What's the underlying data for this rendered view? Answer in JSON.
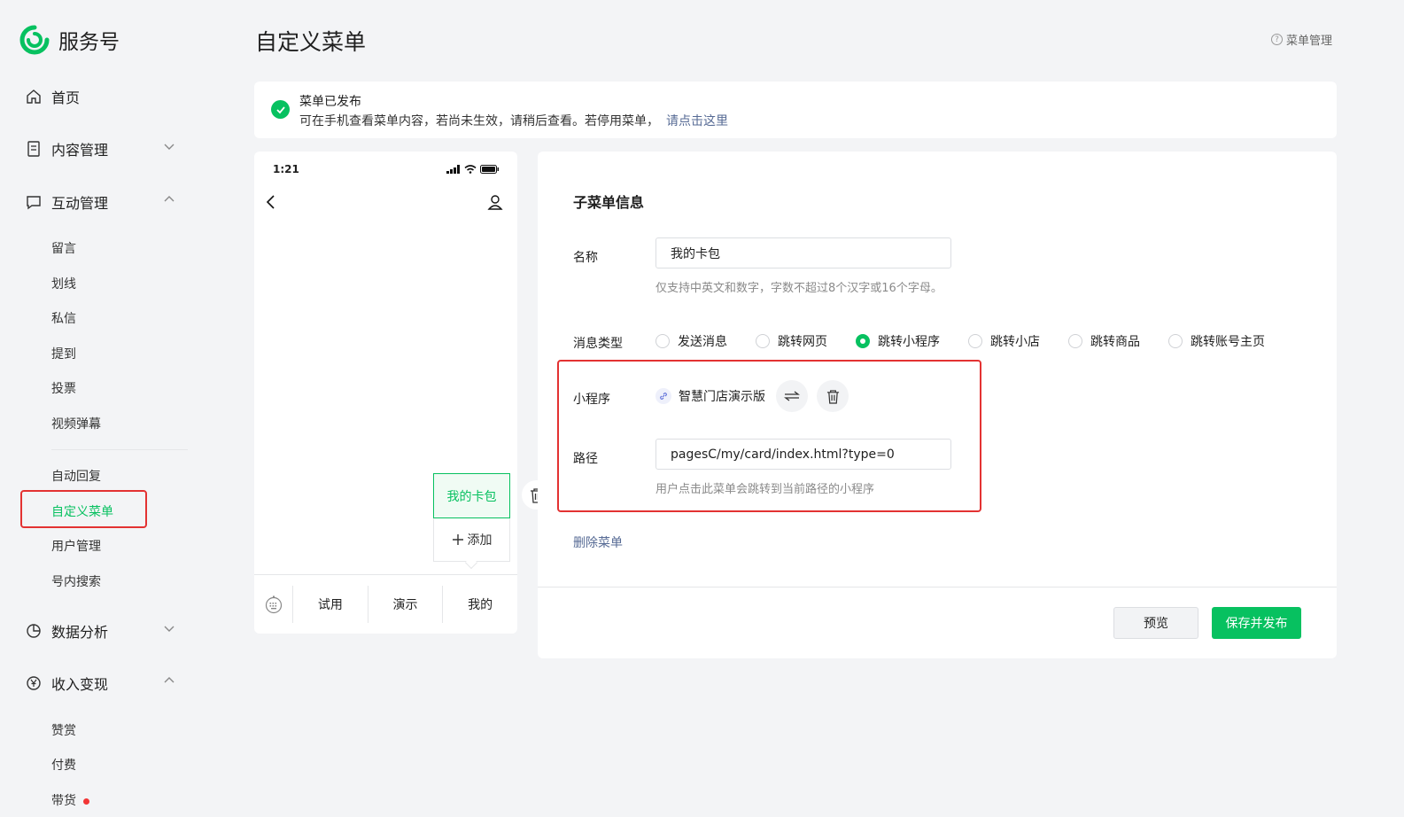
{
  "sidebar": {
    "logo_text": "服务号",
    "home": "首页",
    "content": "内容管理",
    "interact": "互动管理",
    "interact_items": [
      "留言",
      "划线",
      "私信",
      "提到",
      "投票",
      "视频弹幕"
    ],
    "interact_items2": [
      "自动回复",
      "自定义菜单",
      "用户管理",
      "号内搜索"
    ],
    "data": "数据分析",
    "income": "收入变现",
    "income_items": [
      "赞赏",
      "付费",
      "带货"
    ]
  },
  "header": {
    "title": "自定义菜单",
    "help": "菜单管理"
  },
  "notice": {
    "title": "菜单已发布",
    "text": "可在手机查看菜单内容，若尚未生效，请稍后查看。若停用菜单，",
    "link": "请点击这里"
  },
  "phone": {
    "time": "1:21",
    "tabs": [
      "试用",
      "演示",
      "我的"
    ],
    "submenu_current": "我的卡包",
    "submenu_add": "添加"
  },
  "form": {
    "section_title": "子菜单信息",
    "name_label": "名称",
    "name_value": "我的卡包",
    "name_hint": "仅支持中英文和数字，字数不超过8个汉字或16个字母。",
    "type_label": "消息类型",
    "types": [
      "发送消息",
      "跳转网页",
      "跳转小程序",
      "跳转小店",
      "跳转商品",
      "跳转账号主页"
    ],
    "selected_type": "跳转小程序",
    "mp_label": "小程序",
    "mp_name": "智慧门店演示版",
    "path_label": "路径",
    "path_value": "pagesC/my/card/index.html?type=0",
    "path_hint": "用户点击此菜单会跳转到当前路径的小程序",
    "delete_menu": "删除菜单",
    "preview_btn": "预览",
    "publish_btn": "保存并发布"
  },
  "colors": {
    "brand": "#07c160",
    "link": "#576b95",
    "highlight": "#e33232"
  }
}
